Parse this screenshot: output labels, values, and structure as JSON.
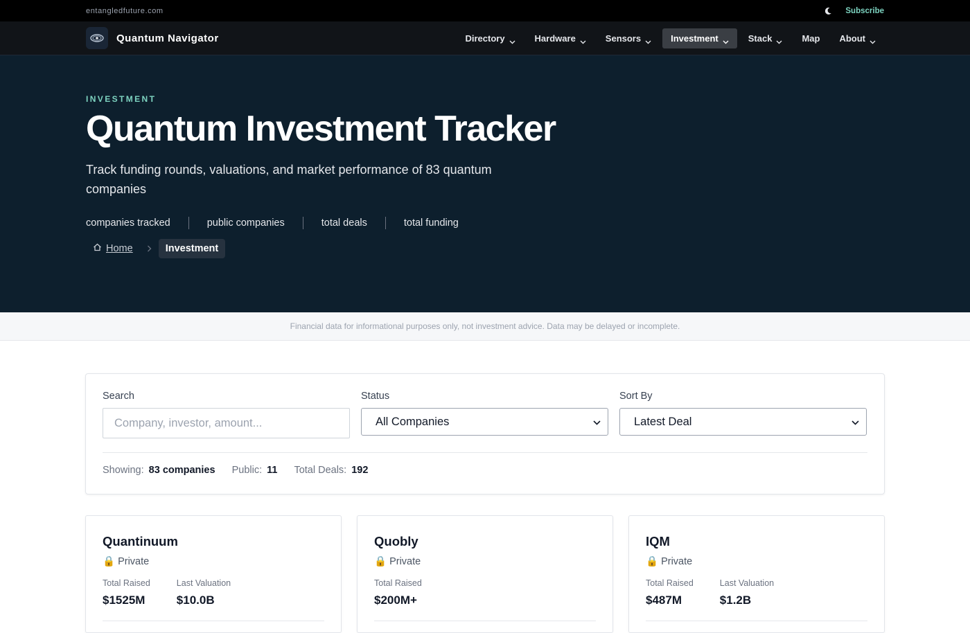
{
  "topbar": {
    "domain": "entangledfuture.com",
    "subscribe": "Subscribe"
  },
  "nav": {
    "brand": "Quantum Navigator",
    "items": [
      {
        "label": "Directory"
      },
      {
        "label": "Hardware"
      },
      {
        "label": "Sensors"
      },
      {
        "label": "Investment"
      },
      {
        "label": "Stack"
      },
      {
        "label": "Map"
      },
      {
        "label": "About"
      }
    ]
  },
  "hero": {
    "eyebrow": "INVESTMENT",
    "title": "Quantum Investment Tracker",
    "subtitle": "Track funding rounds, valuations, and market performance of 83 quantum companies",
    "stats": [
      "companies tracked",
      "public companies",
      "total deals",
      "total funding"
    ],
    "breadcrumb": {
      "home": "Home",
      "current": "Investment"
    }
  },
  "disclaimer": "Financial data for informational purposes only, not investment advice. Data may be delayed or incomplete.",
  "filters": {
    "search": {
      "label": "Search",
      "placeholder": "Company, investor, amount..."
    },
    "status": {
      "label": "Status",
      "value": "All Companies"
    },
    "sort": {
      "label": "Sort By",
      "value": "Latest Deal"
    }
  },
  "summary": {
    "showing_label": "Showing:",
    "showing_value": "83 companies",
    "public_label": "Public:",
    "public_value": "11",
    "deals_label": "Total Deals:",
    "deals_value": "192"
  },
  "cards": [
    {
      "name": "Quantinuum",
      "status": "Private",
      "raised_label": "Total Raised",
      "raised": "$1525M",
      "valuation_label": "Last Valuation",
      "valuation": "$10.0B"
    },
    {
      "name": "Quobly",
      "status": "Private",
      "raised_label": "Total Raised",
      "raised": "$200M+"
    },
    {
      "name": "IQM",
      "status": "Private",
      "raised_label": "Total Raised",
      "raised": "$487M",
      "valuation_label": "Last Valuation",
      "valuation": "$1.2B"
    }
  ],
  "colors": {
    "accent": "#7dd3c0",
    "hero_bg": "#0d1f2d",
    "nav_bg": "#111418"
  }
}
